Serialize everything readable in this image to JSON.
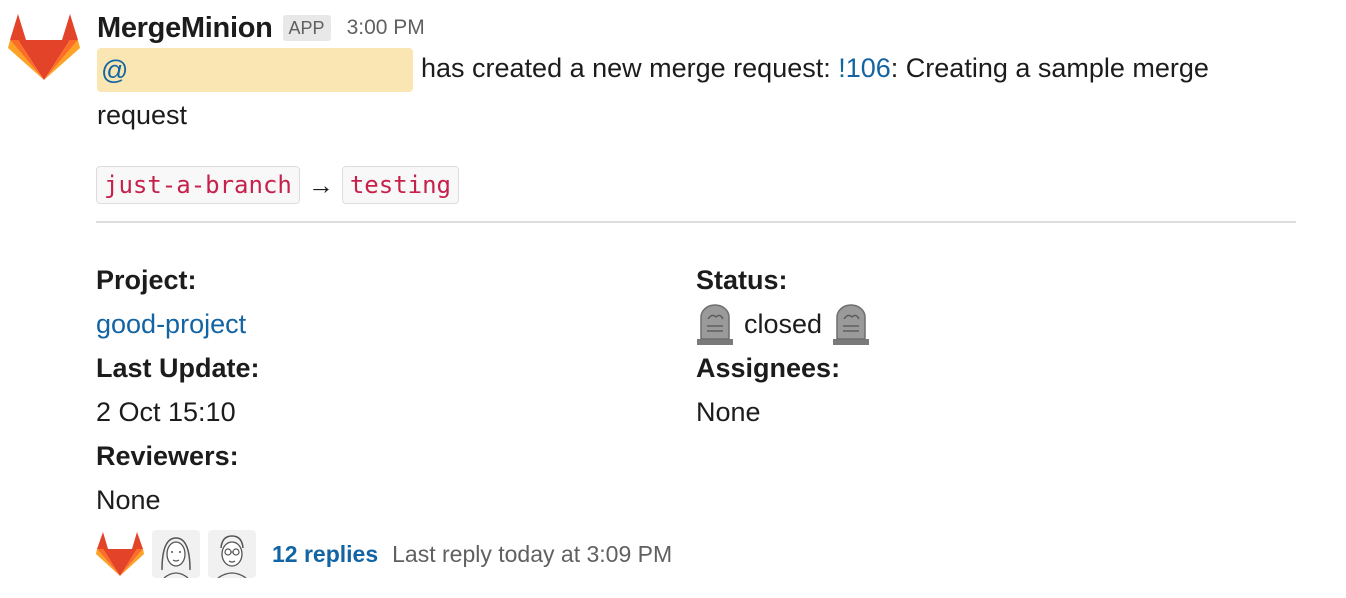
{
  "message": {
    "sender": "MergeMinion",
    "badge": "APP",
    "time": "3:00 PM",
    "mention": "@",
    "text_before_link": "has created a new merge request: ",
    "mr_link": "!106",
    "text_after_link": ": Creating a sample merge",
    "text_wrap": "request"
  },
  "branches": {
    "source": "just-a-branch",
    "arrow": "→",
    "target": "testing"
  },
  "fields": {
    "project_label": "Project:",
    "project_value": "good-project",
    "last_update_label": "Last Update:",
    "last_update_value": "2 Oct 15:10",
    "reviewers_label": "Reviewers:",
    "reviewers_value": "None",
    "status_label": "Status:",
    "status_value": "closed",
    "assignees_label": "Assignees:",
    "assignees_value": "None"
  },
  "thread": {
    "reply_count": "12 replies",
    "last_reply": "Last reply today at 3:09 PM"
  },
  "colors": {
    "link": "#1264a3",
    "mention_bg": "#f9e6b2",
    "code_text": "#c6214a",
    "gitlab_orange": "#e24329",
    "gitlab_light": "#fca326",
    "gitlab_mid": "#fc6d26"
  },
  "icons": {
    "avatar": "gitlab-fox-icon",
    "status": "headstone-icon",
    "reply_avatars": [
      "gitlab-fox-icon",
      "person-avatar-icon",
      "person-avatar-icon"
    ]
  }
}
